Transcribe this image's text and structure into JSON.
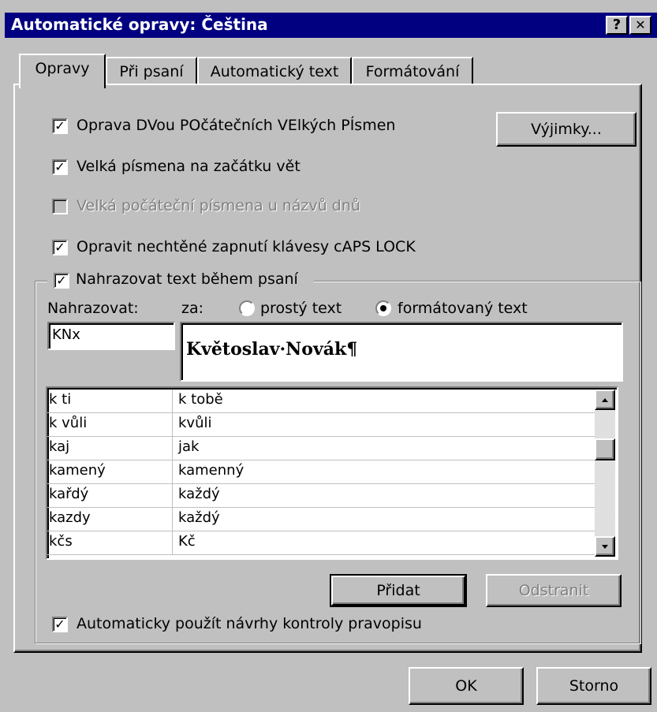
{
  "window": {
    "title": "Automatické opravy: Čeština",
    "help_btn": "?",
    "close_btn": "✕"
  },
  "tabs": [
    {
      "label": "Opravy",
      "active": true
    },
    {
      "label": "Při psaní",
      "active": false
    },
    {
      "label": "Automatický text",
      "active": false
    },
    {
      "label": "Formátování",
      "active": false
    }
  ],
  "options": {
    "two_initial_caps": {
      "label": "Oprava DVou POčátečních VElkých PÍsmen",
      "checked": true
    },
    "sentence_caps": {
      "label": "Velká písmena na začátku vět",
      "checked": true
    },
    "day_names": {
      "label": "Velká počáteční písmena u názvů dnů",
      "checked": false,
      "disabled": true
    },
    "caps_lock": {
      "label": "Opravit nechtěné zapnutí klávesy cAPS LOCK",
      "checked": true
    },
    "replace_text": {
      "label": "Nahrazovat text během psaní",
      "checked": true
    },
    "auto_spell": {
      "label": "Automaticky použít návrhy kontroly pravopisu",
      "checked": true
    }
  },
  "exceptions_button": "Výjimky...",
  "replace": {
    "replace_label": "Nahrazovat:",
    "with_label": "za:",
    "plain_text": "prostý text",
    "formatted_text": "formátovaný text",
    "selected_mode": "formatted",
    "replace_value": "KNx",
    "with_value": "Květoslav·Novák¶"
  },
  "entries": [
    {
      "from": "k ti",
      "to": "k tobě"
    },
    {
      "from": "k vůli",
      "to": "kvůli"
    },
    {
      "from": "kaj",
      "to": "jak"
    },
    {
      "from": "kamený",
      "to": "kamenný"
    },
    {
      "from": "kařdý",
      "to": "každý"
    },
    {
      "from": "kazdy",
      "to": "každý"
    },
    {
      "from": "kčs",
      "to": "Kč"
    }
  ],
  "buttons": {
    "add": "Přidat",
    "remove": "Odstranit",
    "ok": "OK",
    "cancel": "Storno"
  },
  "colors": {
    "titlebar": "#000080",
    "face": "#c0c0c0",
    "shadow": "#808080"
  }
}
